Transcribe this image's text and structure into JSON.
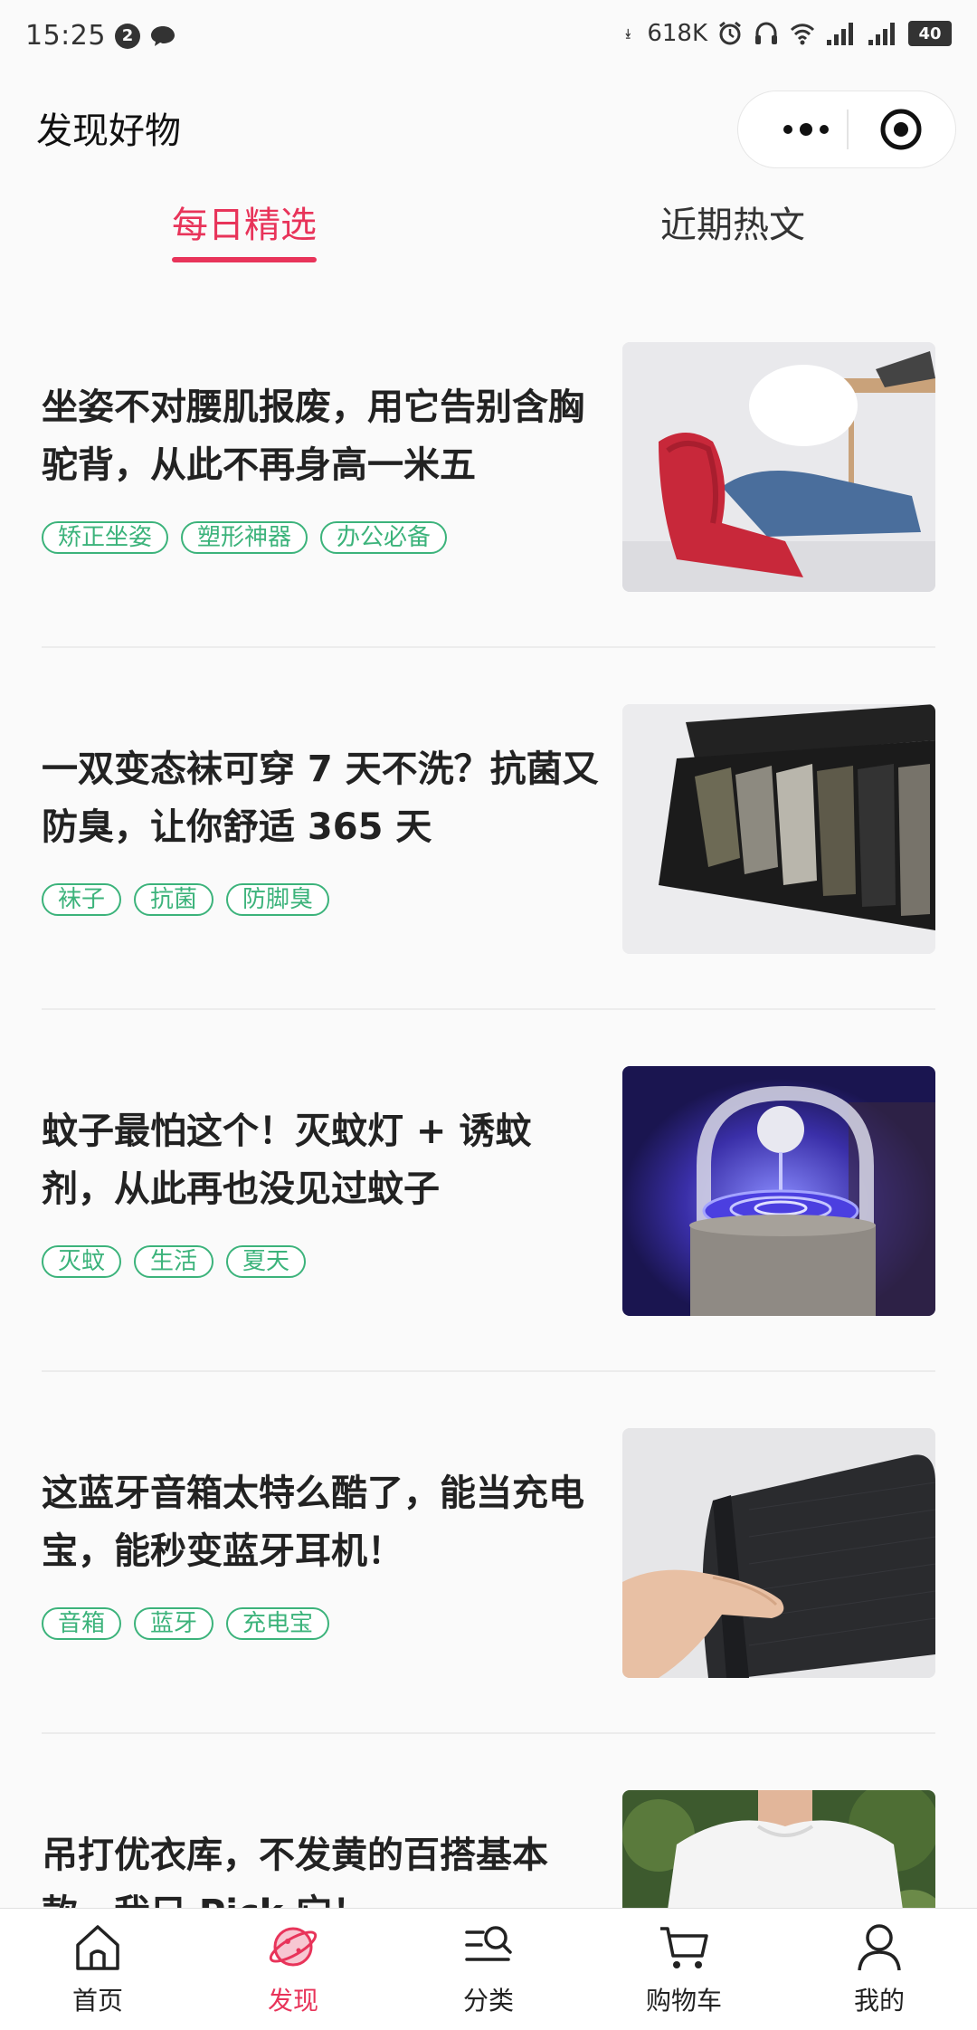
{
  "status_bar": {
    "time": "15:25",
    "notification_count": "2",
    "net_speed": "618K",
    "battery": "40"
  },
  "header": {
    "title": "发现好物"
  },
  "tabs": [
    {
      "label": "每日精选",
      "active": true
    },
    {
      "label": "近期热文",
      "active": false
    }
  ],
  "articles": [
    {
      "title": "坐姿不对腰肌报废，用它告别含胸驼背，从此不再身高一米五",
      "tags": [
        "矫正坐姿",
        "塑形神器",
        "办公必备"
      ],
      "image": "posture-seat-photo"
    },
    {
      "title": "一双变态袜可穿 7 天不洗？抗菌又防臭，让你舒适 365 天",
      "tags": [
        "袜子",
        "抗菌",
        "防脚臭"
      ],
      "image": "socks-box-photo"
    },
    {
      "title": "蚊子最怕这个！灭蚊灯 + 诱蚊剂，从此再也没见过蚊子",
      "tags": [
        "灭蚊",
        "生活",
        "夏天"
      ],
      "image": "mosquito-lamp-photo"
    },
    {
      "title": "这蓝牙音箱太特么酷了，能当充电宝，能秒变蓝牙耳机！",
      "tags": [
        "音箱",
        "蓝牙",
        "充电宝"
      ],
      "image": "bluetooth-speaker-photo"
    },
    {
      "title": "吊打优衣库，不发黄的百搭基本款，我只 Pick 它！",
      "tags": [],
      "image": "white-tshirt-photo"
    }
  ],
  "tabbar": [
    {
      "label": "首页",
      "icon": "home-icon",
      "active": false
    },
    {
      "label": "发现",
      "icon": "planet-icon",
      "active": true
    },
    {
      "label": "分类",
      "icon": "category-search-icon",
      "active": false
    },
    {
      "label": "购物车",
      "icon": "cart-icon",
      "active": false
    },
    {
      "label": "我的",
      "icon": "profile-icon",
      "active": false
    }
  ],
  "colors": {
    "accent": "#e8345a",
    "tag_green": "#3cb37b"
  }
}
